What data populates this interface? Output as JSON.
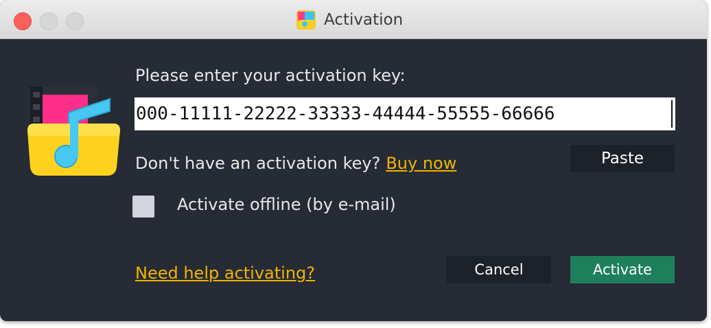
{
  "window": {
    "title": "Activation",
    "controls": [
      "close",
      "minimize",
      "zoom"
    ]
  },
  "app_icon": "movavi-music-folder-icon",
  "form": {
    "prompt": "Please enter your activation key:",
    "key_value": "000-11111-22222-33333-44444-55555-66666",
    "no_key_text": "Don't have an activation key?",
    "buy_link": "Buy now",
    "paste_label": "Paste",
    "offline_checked": false,
    "offline_label": "Activate offline (by e-mail)"
  },
  "footer": {
    "help_link": "Need help activating?",
    "cancel_label": "Cancel",
    "activate_label": "Activate"
  },
  "colors": {
    "background": "#262b35",
    "link": "#f2b400",
    "activate_button": "#1e7f5d",
    "secondary_button": "#1d2129",
    "close_button": "#fc605b"
  }
}
